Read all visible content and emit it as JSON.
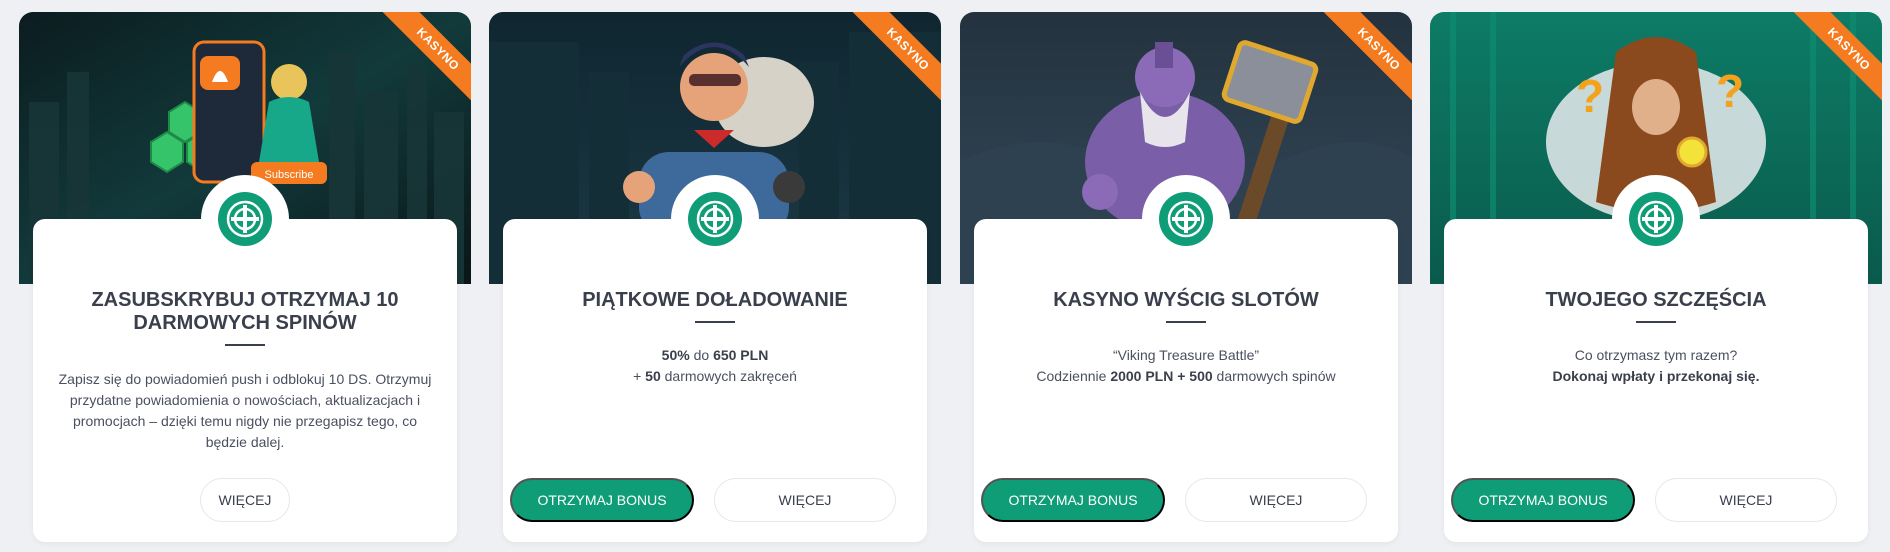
{
  "cards": [
    {
      "ribbon": "KASYNO",
      "title": "ZASUBSKRYBUJ OTRZYMAJ 10 DARMOWYCH SPINÓW",
      "description": "Zapisz się do powiadomień push i odblokuj 10 DS. Otrzymuj przydatne powiadomienia o nowościach, aktualizacjach i promocjach – dzięki temu nigdy nie przegapisz tego, co będzie dalej.",
      "button_more": "WIĘCEJ",
      "image_text": "Subscribe"
    },
    {
      "ribbon": "KASYNO",
      "title": "PIĄTKOWE DOŁADOWANIE",
      "line1_bold_a": "50%",
      "line1_text": " do ",
      "line1_bold_b": "650 PLN",
      "line2_text_a": "+ ",
      "line2_bold": "50",
      "line2_text_b": " darmowych zakręceń",
      "button_bonus": "OTRZYMAJ BONUS",
      "button_more": "WIĘCEJ"
    },
    {
      "ribbon": "KASYNO",
      "title": "KASYNO WYŚCIG SLOTÓW",
      "line1": "“Viking Treasure Battle”",
      "line2_text_a": "Codziennie ",
      "line2_bold": "2000 PLN + 500",
      "line2_text_b": " darmowych spinów",
      "button_bonus": "OTRZYMAJ BONUS",
      "button_more": "WIĘCEJ"
    },
    {
      "ribbon": "KASYNO",
      "title": "TWOJEGO SZCZĘŚCIA",
      "line1": "Co otrzymasz tym razem?",
      "line2_bold": "Dokonaj wpłaty i przekonaj się.",
      "button_bonus": "OTRZYMAJ BONUS",
      "button_more": "WIĘCEJ"
    }
  ],
  "colors": {
    "accent": "#0f9d78",
    "ribbon": "#f47b20",
    "background": "#eef0f3"
  },
  "icons": {
    "badge": "roulette-wheel-icon"
  }
}
